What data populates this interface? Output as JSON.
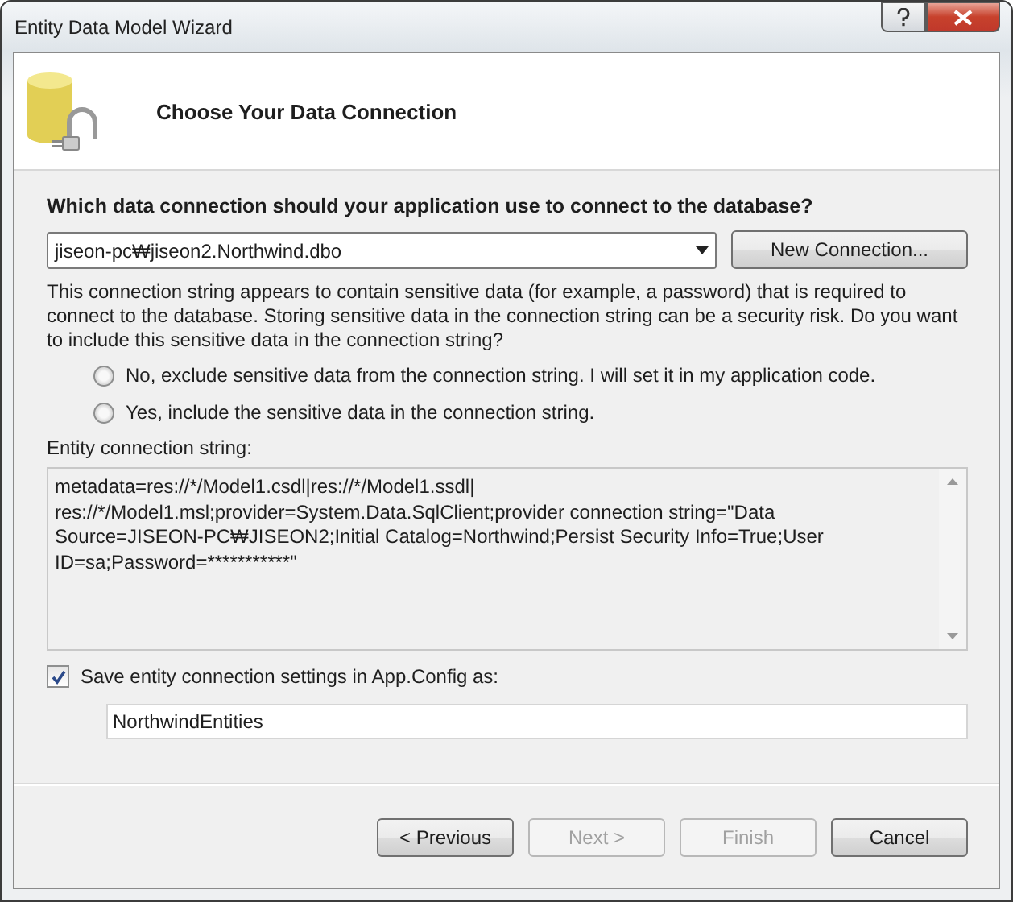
{
  "window": {
    "title": "Entity Data Model Wizard"
  },
  "header": {
    "title": "Choose Your Data Connection"
  },
  "question": "Which data connection should your application use to connect to the database?",
  "connection": {
    "value": "jiseon-pc₩jiseon2.Northwind.dbo",
    "new_button": "New Connection..."
  },
  "warning": "This connection string appears to contain sensitive data (for example, a password) that is required to connect to the database. Storing sensitive data in the connection string can be a security risk. Do you want to include this sensitive data in the connection string?",
  "options": [
    {
      "label": "No, exclude sensitive data from the connection string. I will set it in my application code.",
      "selected": false
    },
    {
      "label": "Yes, include the sensitive data in the connection string.",
      "selected": false
    }
  ],
  "entity_string": {
    "label": "Entity connection string:",
    "lines": [
      "metadata=res://*/Model1.csdl|res://*/Model1.ssdl|",
      "res://*/Model1.msl;provider=System.Data.SqlClient;provider connection string=\"Data",
      "Source=JISEON-PC₩JISEON2;Initial Catalog=Northwind;Persist Security Info=True;User",
      "ID=sa;Password=***********\""
    ]
  },
  "save_settings": {
    "label": "Save entity connection settings in App.Config as:",
    "checked": true,
    "value": "NorthwindEntities"
  },
  "buttons": [
    {
      "label": "< Previous",
      "disabled": false
    },
    {
      "label": "Next >",
      "disabled": true
    },
    {
      "label": "Finish",
      "disabled": true
    },
    {
      "label": "Cancel",
      "disabled": false
    }
  ]
}
